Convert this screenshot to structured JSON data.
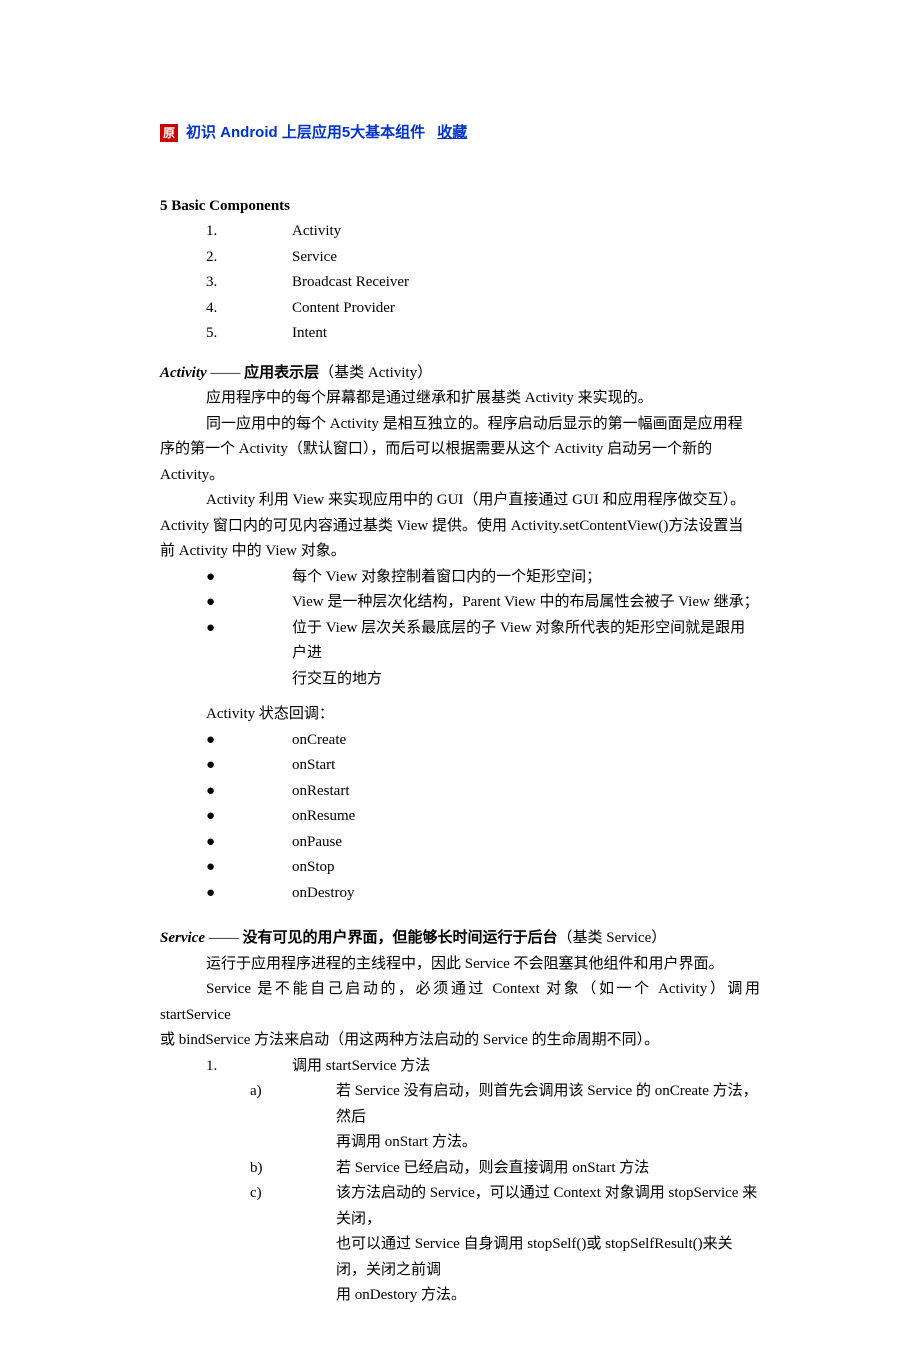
{
  "header": {
    "badge": "原",
    "title_prefix": "初识 ",
    "title_bold": "Android",
    "title_suffix": " 上层应用5大基本组件",
    "collect": "收藏"
  },
  "sec1": {
    "heading": "5 Basic Components",
    "items": [
      {
        "n": "1.",
        "t": "Activity"
      },
      {
        "n": "2.",
        "t": "Service"
      },
      {
        "n": "3.",
        "t": "Broadcast Receiver"
      },
      {
        "n": "4.",
        "t": "Content Provider"
      },
      {
        "n": "5.",
        "t": "Intent"
      }
    ]
  },
  "activity": {
    "heading_em": "Activity",
    "dash": " —— ",
    "heading_bold": "应用表示层",
    "heading_tail": "（基类 Activity）",
    "p1": "应用程序中的每个屏幕都是通过继承和扩展基类 Activity 来实现的。",
    "p2_a": "同一应用中的每个 Activity 是相互独立的。程序启动后显示的第一幅画面是应用程",
    "p2_b": "序的第一个 Activity（默认窗口），而后可以根据需要从这个 Activity 启动另一个新的",
    "p2_c": "Activity。",
    "p3_a": "Activity 利用 View 来实现应用中的 GUI（用户直接通过 GUI 和应用程序做交互）。",
    "p3_b": "Activity 窗口内的可见内容通过基类 View 提供。使用 Activity.setContentView()方法设置当",
    "p3_c": "前 Activity 中的 View 对象。",
    "b1": "每个 View 对象控制着窗口内的一个矩形空间；",
    "b2": "View 是一种层次化结构，Parent View 中的布局属性会被子 View 继承；",
    "b3_a": "位于 View 层次关系最底层的子 View 对象所代表的矩形空间就是跟用户进",
    "b3_b": "行交互的地方",
    "cb_title": "Activity 状态回调：",
    "cbs": [
      "onCreate",
      "onStart",
      "onRestart",
      "onResume",
      "onPause",
      "onStop",
      "onDestroy"
    ]
  },
  "service": {
    "heading_em": "Service",
    "dash": " —— ",
    "heading_bold": "没有可见的用户界面，但能够长时间运行于后台",
    "heading_tail": "（基类 Service）",
    "p1": "运行于应用程序进程的主线程中，因此 Service 不会阻塞其他组件和用户界面。",
    "p2_a": "Service 是不能自己启动的，必须通过 Context 对象（如一个 Activity）调用 startService",
    "p2_b": "或 bindService 方法来启动（用这两种方法启动的 Service 的生命周期不同）。",
    "o1_marker": "1.",
    "o1_text": "调用 startService 方法",
    "a_marker": "a)",
    "a_a": "若 Service 没有启动，则首先会调用该 Service 的 onCreate 方法，然后",
    "a_b": "再调用 onStart 方法。",
    "b_marker": "b)",
    "b_a": "若 Service 已经启动，则会直接调用 onStart 方法",
    "c_marker": "c)",
    "c_a": "该方法启动的 Service，可以通过 Context 对象调用 stopService 来关闭，",
    "c_b": "也可以通过 Service 自身调用 stopSelf()或 stopSelfResult()来关闭，关闭之前调",
    "c_c": "用 onDestory 方法。"
  }
}
